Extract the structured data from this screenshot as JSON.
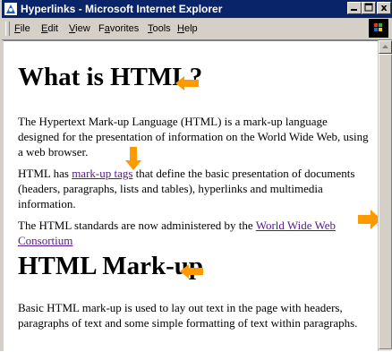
{
  "window": {
    "title": "Hyperlinks - Microsoft Internet Explorer",
    "title_bar_color": "#0a246a"
  },
  "controls": {
    "minimize_icon": "minimize-icon",
    "maximize_icon": "maximize-icon",
    "close_icon": "close-icon",
    "close_glyph": "x"
  },
  "menu": {
    "items": [
      {
        "label": "File",
        "mnemonic": "F"
      },
      {
        "label": "Edit",
        "mnemonic": "E"
      },
      {
        "label": "View",
        "mnemonic": "V"
      },
      {
        "label": "Favorites",
        "mnemonic": "a"
      },
      {
        "label": "Tools",
        "mnemonic": "T"
      },
      {
        "label": "Help",
        "mnemonic": "H"
      }
    ]
  },
  "page": {
    "heading1": "What is HTML?",
    "para1": "The Hypertext Mark-up Language (HTML) is a mark-up language designed for the presentation of information on the World Wide Web, using a web browser.",
    "para2_before": "HTML has ",
    "para2_link": "mark-up tags",
    "para2_after": " that define the basic presentation of documents (headers, paragraphs, lists and tables), hyperlinks and multimedia information.",
    "para3_before": "The HTML standards are now administered by the ",
    "para3_link": "World Wide Web Consortium",
    "heading2": "HTML Mark-up",
    "para4": "Basic HTML mark-up is used to lay out text in the page with headers, paragraphs of text and some simple formatting of text within paragraphs.",
    "link_color": "#551a8b",
    "annotation_arrow_color": "#ff9900"
  }
}
